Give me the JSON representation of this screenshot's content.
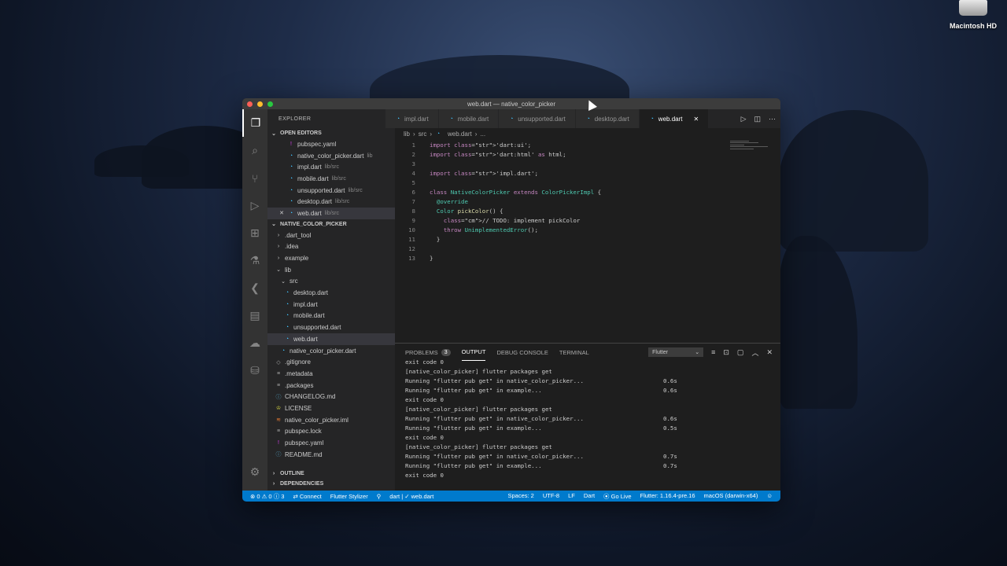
{
  "desktop": {
    "drive_label": "Macintosh HD"
  },
  "window": {
    "title": "web.dart — native_color_picker"
  },
  "activity_bar": [
    "explorer-icon",
    "search-icon",
    "source-control-icon",
    "run-debug-icon",
    "extensions-icon",
    "testing-icon",
    "flutter-icon",
    "browser-icon",
    "docker-icon",
    "database-icon",
    "settings-icon"
  ],
  "sidebar": {
    "title": "EXPLORER",
    "open_editors_label": "OPEN EDITORS",
    "open_editors": [
      {
        "name": "pubspec.yaml",
        "path": "",
        "icon": "yaml"
      },
      {
        "name": "native_color_picker.dart",
        "path": "lib",
        "icon": "dart"
      },
      {
        "name": "impl.dart",
        "path": "lib/src",
        "icon": "dart"
      },
      {
        "name": "mobile.dart",
        "path": "lib/src",
        "icon": "dart"
      },
      {
        "name": "unsupported.dart",
        "path": "lib/src",
        "icon": "dart"
      },
      {
        "name": "desktop.dart",
        "path": "lib/src",
        "icon": "dart"
      },
      {
        "name": "web.dart",
        "path": "lib/src",
        "icon": "dart"
      }
    ],
    "project_label": "NATIVE_COLOR_PICKER",
    "tree": [
      {
        "name": ".dart_tool",
        "icon": "chevron-right"
      },
      {
        "name": ".idea",
        "icon": "chevron-right"
      },
      {
        "name": "example",
        "icon": "chevron-right"
      },
      {
        "name": "lib",
        "icon": "chevron-down"
      },
      {
        "name": "src",
        "icon": "chevron-down"
      },
      {
        "name": "desktop.dart",
        "icon": "dart"
      },
      {
        "name": "impl.dart",
        "icon": "dart"
      },
      {
        "name": "mobile.dart",
        "icon": "dart"
      },
      {
        "name": "unsupported.dart",
        "icon": "dart"
      },
      {
        "name": "web.dart",
        "icon": "dart"
      },
      {
        "name": "native_color_picker.dart",
        "icon": "dart"
      },
      {
        "name": ".gitignore",
        "icon": "git"
      },
      {
        "name": ".metadata",
        "icon": "lines"
      },
      {
        "name": ".packages",
        "icon": "lines"
      },
      {
        "name": "CHANGELOG.md",
        "icon": "info"
      },
      {
        "name": "LICENSE",
        "icon": "license"
      },
      {
        "name": "native_color_picker.iml",
        "icon": "iml"
      },
      {
        "name": "pubspec.lock",
        "icon": "lines"
      },
      {
        "name": "pubspec.yaml",
        "icon": "yaml"
      },
      {
        "name": "README.md",
        "icon": "info"
      }
    ],
    "outline_label": "OUTLINE",
    "dependencies_label": "DEPENDENCIES"
  },
  "tabs": [
    {
      "label": "impl.dart",
      "active": false
    },
    {
      "label": "mobile.dart",
      "active": false
    },
    {
      "label": "unsupported.dart",
      "active": false
    },
    {
      "label": "desktop.dart",
      "active": false
    },
    {
      "label": "web.dart",
      "active": true
    }
  ],
  "breadcrumb": [
    "lib",
    "src",
    "web.dart",
    "..."
  ],
  "code": [
    {
      "n": "1",
      "text": "import 'dart:ui';"
    },
    {
      "n": "2",
      "text": "import 'dart:html' as html;"
    },
    {
      "n": "3",
      "text": ""
    },
    {
      "n": "4",
      "text": "import 'impl.dart';"
    },
    {
      "n": "5",
      "text": ""
    },
    {
      "n": "6",
      "text": "class NativeColorPicker extends ColorPickerImpl {"
    },
    {
      "n": "7",
      "text": "  @override"
    },
    {
      "n": "8",
      "text": "  Color pickColor() {"
    },
    {
      "n": "9",
      "text": "    // TODO: implement pickColor"
    },
    {
      "n": "10",
      "text": "    throw UnimplementedError();"
    },
    {
      "n": "11",
      "text": "  }"
    },
    {
      "n": "12",
      "text": ""
    },
    {
      "n": "13",
      "text": "}"
    }
  ],
  "panel": {
    "tabs": [
      {
        "label": "PROBLEMS",
        "badge": "3",
        "active": false
      },
      {
        "label": "OUTPUT",
        "active": true
      },
      {
        "label": "DEBUG CONSOLE",
        "active": false
      },
      {
        "label": "TERMINAL",
        "active": false
      }
    ],
    "channel": "Flutter",
    "output": [
      {
        "text": "exit code 0",
        "time": ""
      },
      {
        "text": "[native_color_picker] flutter packages get",
        "time": ""
      },
      {
        "text": "Running \"flutter pub get\" in native_color_picker...",
        "time": "0.6s"
      },
      {
        "text": "Running \"flutter pub get\" in example...",
        "time": "0.6s"
      },
      {
        "text": "exit code 0",
        "time": ""
      },
      {
        "text": "[native_color_picker] flutter packages get",
        "time": ""
      },
      {
        "text": "Running \"flutter pub get\" in native_color_picker...",
        "time": "0.6s"
      },
      {
        "text": "Running \"flutter pub get\" in example...",
        "time": "0.5s"
      },
      {
        "text": "exit code 0",
        "time": ""
      },
      {
        "text": "[native_color_picker] flutter packages get",
        "time": ""
      },
      {
        "text": "Running \"flutter pub get\" in native_color_picker...",
        "time": "0.7s"
      },
      {
        "text": "Running \"flutter pub get\" in example...",
        "time": "0.7s"
      },
      {
        "text": "exit code 0",
        "time": ""
      }
    ]
  },
  "status": {
    "problems": "⊗ 0 ⚠ 0 ⓘ 3",
    "connect": "Connect",
    "stylizer": "Flutter Stylizer",
    "lint": "dart | ✓ web.dart",
    "spaces": "Spaces: 2",
    "encoding": "UTF-8",
    "eol": "LF",
    "language": "Dart",
    "golive": "Go Live",
    "flutter": "Flutter: 1.16.4-pre.16",
    "device": "macOS (darwin-x64)"
  },
  "colors": {
    "accent": "#007acc",
    "close": "#ff5f57",
    "minimize": "#febc2e",
    "maximize": "#28c840"
  }
}
